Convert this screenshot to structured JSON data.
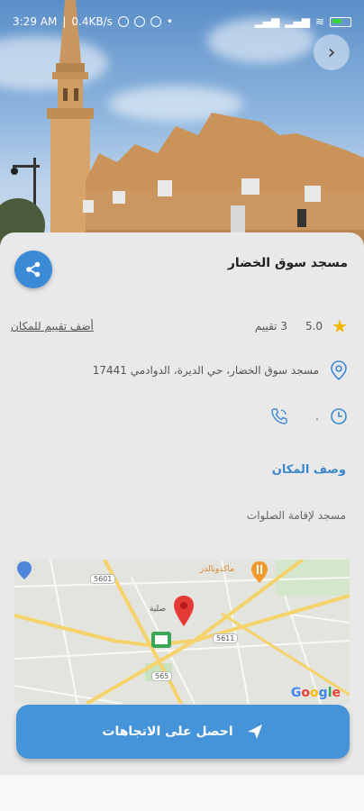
{
  "status_bar": {
    "time": "3:29 AM",
    "speed": "0.4KB/s"
  },
  "place": {
    "title": "مسجد سوق الخضار",
    "rating": "5.0",
    "rating_count": "3 تقييم",
    "add_rating": "أضف تقييم للمكان",
    "address": "مسجد سوق الخضار، حي الديرة، الدوادمي 17441",
    "hours": ".",
    "section_title": "وصف المكان",
    "description": "مسجد لإقامة الصلوات"
  },
  "map": {
    "labels": {
      "mcdonalds": "ماكدونالدز",
      "place": "صلية"
    },
    "road_numbers": [
      "5601",
      "5611",
      "565"
    ],
    "attribution": "Google"
  },
  "directions_button": {
    "label": "احصل على الاتجاهات"
  },
  "colors": {
    "accent": "#3b8ad6",
    "star": "#f2b705",
    "button": "#4593d9"
  }
}
